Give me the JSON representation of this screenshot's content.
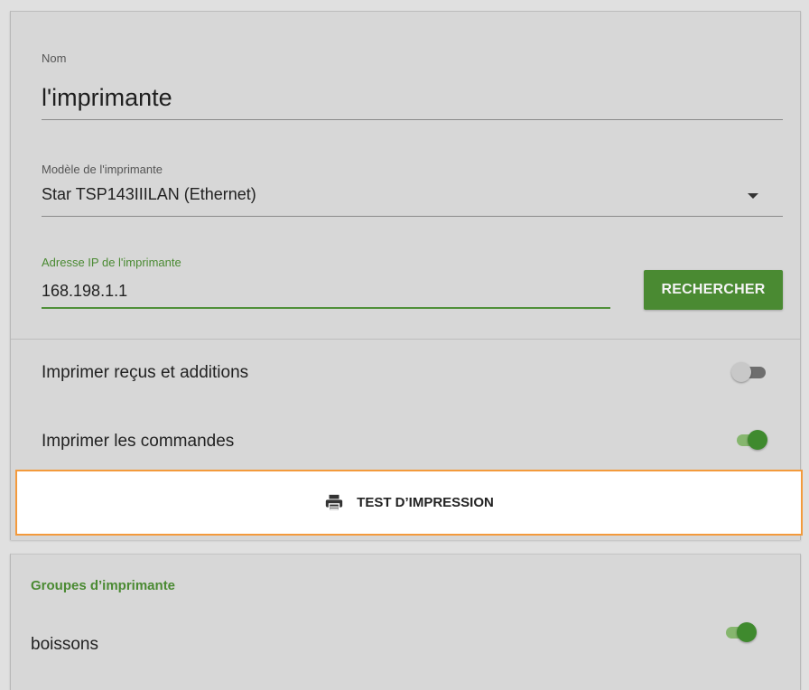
{
  "printer_form": {
    "name": {
      "label": "Nom",
      "value": "l'imprimante"
    },
    "model": {
      "label": "Modèle de l'imprimante",
      "value": "Star TSP143IIILAN (Ethernet)"
    },
    "ip": {
      "label": "Adresse IP de l'imprimante",
      "value": "168.198.1.1"
    },
    "search_button": "RECHERCHER"
  },
  "toggles": {
    "receipts": {
      "label": "Imprimer reçus et additions",
      "on": false
    },
    "orders": {
      "label": "Imprimer les commandes",
      "on": true
    }
  },
  "test_print": {
    "label": "TEST D’IMPRESSION",
    "icon": "printer-icon"
  },
  "groups": {
    "title": "Groupes d’imprimante",
    "items": [
      {
        "label": "boissons",
        "on": true
      }
    ]
  },
  "colors": {
    "accent_green": "#4a8a32",
    "highlight_orange": "#f39a3c",
    "background": "#d7d7d7"
  }
}
